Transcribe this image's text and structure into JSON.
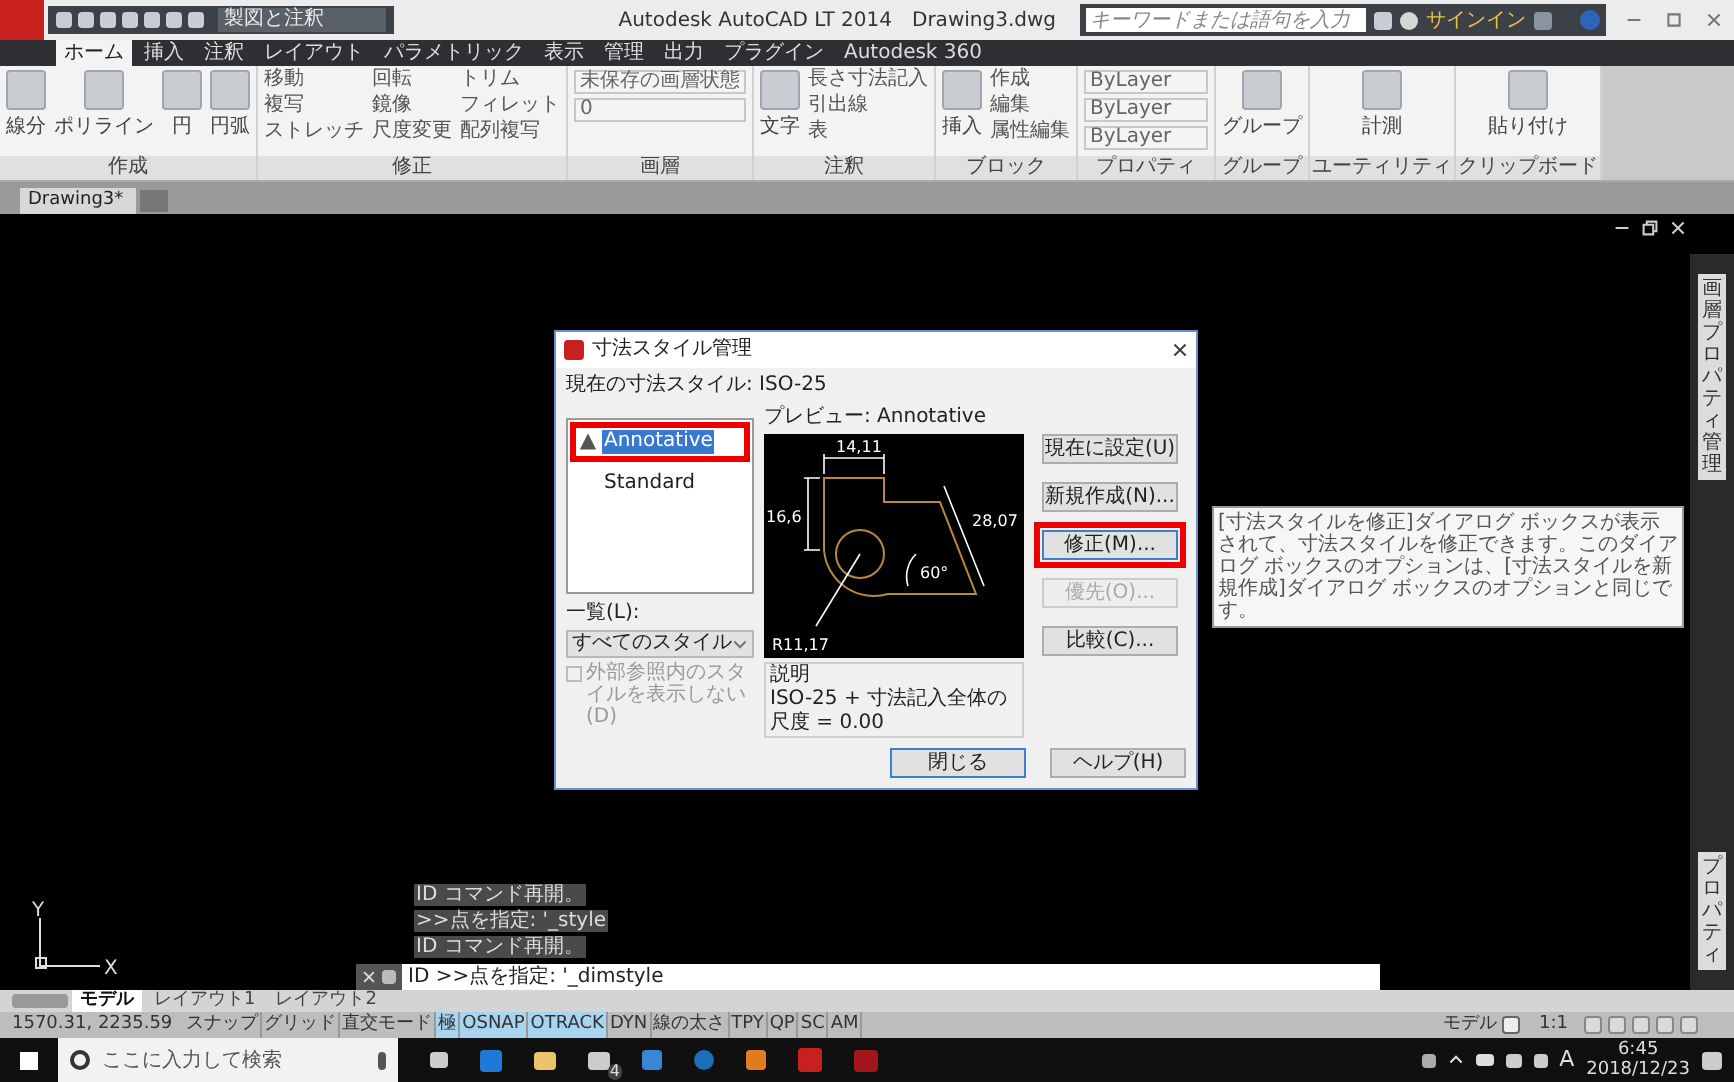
{
  "titlebar": {
    "workspace": "製図と注釈",
    "title": "Autodesk AutoCAD LT 2014",
    "file": "Drawing3.dwg",
    "search": {
      "placeholder": "キーワードまたは語句を入力"
    },
    "signin": "サインイン"
  },
  "ribbon_tabs": [
    {
      "label": "ホーム",
      "selected": true
    },
    {
      "label": "挿入",
      "selected": false
    },
    {
      "label": "注釈",
      "selected": false
    },
    {
      "label": "レイアウト",
      "selected": false
    },
    {
      "label": "パラメトリック",
      "selected": false
    },
    {
      "label": "表示",
      "selected": false
    },
    {
      "label": "管理",
      "selected": false
    },
    {
      "label": "出力",
      "selected": false
    },
    {
      "label": "プラグイン",
      "selected": false
    },
    {
      "label": "Autodesk 360",
      "selected": false
    }
  ],
  "ribbon_panels": [
    {
      "title": "作成",
      "groups": [
        {
          "kind": "large",
          "label": "線分"
        },
        {
          "kind": "large",
          "label": "ポリライン"
        },
        {
          "kind": "large",
          "label": "円"
        },
        {
          "kind": "large",
          "label": "円弧"
        }
      ]
    },
    {
      "title": "修正",
      "groups": [
        {
          "kind": "column",
          "items": [
            "移動",
            "複写",
            "ストレッチ"
          ]
        },
        {
          "kind": "column",
          "items": [
            "回転",
            "鏡像",
            "尺度変更"
          ]
        },
        {
          "kind": "column",
          "items": [
            "トリム",
            "フィレット",
            "配列複写"
          ]
        }
      ]
    },
    {
      "title": "画層",
      "groups": [
        {
          "kind": "dropdown",
          "items": [
            "未保存の画層状態",
            "0"
          ]
        }
      ]
    },
    {
      "title": "注釈",
      "groups": [
        {
          "kind": "large",
          "label": "文字"
        },
        {
          "kind": "column",
          "items": [
            "長さ寸法記入",
            "引出線",
            "表"
          ]
        }
      ]
    },
    {
      "title": "ブロック",
      "groups": [
        {
          "kind": "large",
          "label": "挿入"
        },
        {
          "kind": "column",
          "items": [
            "作成",
            "編集",
            "属性編集"
          ]
        }
      ]
    },
    {
      "title": "プロパティ",
      "groups": [
        {
          "kind": "dropdown",
          "items": [
            "ByLayer",
            "ByLayer",
            "ByLayer"
          ]
        }
      ]
    },
    {
      "title": "グループ",
      "groups": [
        {
          "kind": "large",
          "label": "グループ"
        }
      ]
    },
    {
      "title": "ユーティリティ",
      "groups": [
        {
          "kind": "large",
          "label": "計測"
        }
      ]
    },
    {
      "title": "クリップボード",
      "groups": [
        {
          "kind": "large",
          "label": "貼り付け"
        }
      ]
    }
  ],
  "doc_tabs": [
    {
      "label": "Drawing3*",
      "selected": true
    }
  ],
  "palettes": [
    {
      "label": "画層プロパティ管理"
    },
    {
      "label": "プロパティ"
    }
  ],
  "ucs": {
    "x": "X",
    "y": "Y"
  },
  "dialog": {
    "title": "寸法スタイル管理",
    "current": "現在の寸法スタイル: ISO-25",
    "styles": [
      {
        "name": "Annotative",
        "annotative": true,
        "selected": true,
        "highlighted": true
      },
      {
        "name": "Standard",
        "annotative": false,
        "selected": false,
        "highlighted": false
      }
    ],
    "list_label": "一覧(L):",
    "list_value": "すべてのスタイル",
    "xref_checkbox": {
      "label": "外部参照内のスタイルを表示しない(D)",
      "checked": false,
      "disabled": true
    },
    "preview_label": "プレビュー: Annotative",
    "preview_dims": [
      "14,11",
      "16,6",
      "28,07",
      "60°",
      "R11,17"
    ],
    "description_label": "説明",
    "description": "ISO-25 + 寸法記入全体の尺度 = 0.00",
    "side_buttons": [
      {
        "label": "現在に設定(U)",
        "disabled": false,
        "focused": false,
        "highlighted": false
      },
      {
        "label": "新規作成(N)...",
        "disabled": false,
        "focused": false,
        "highlighted": false
      },
      {
        "label": "修正(M)...",
        "disabled": false,
        "focused": true,
        "highlighted": true
      },
      {
        "label": "優先(O)...",
        "disabled": true,
        "focused": false,
        "highlighted": false
      },
      {
        "label": "比較(C)...",
        "disabled": false,
        "focused": false,
        "highlighted": false
      }
    ],
    "bottom_buttons": [
      {
        "label": "閉じる",
        "focused": true
      },
      {
        "label": "ヘルプ(H)",
        "focused": false
      }
    ]
  },
  "tooltip": "[寸法スタイルを修正]ダイアログ ボックスが表示されて、寸法スタイルを修正できます。このダイアログ ボックスのオプションは、[寸法スタイルを新規作成]ダイアログ ボックスのオプションと同じです。",
  "command_history": [
    "ID コマンド再開。",
    ">>点を指定: '_style",
    "ID コマンド再開。"
  ],
  "command_line": "ID >>点を指定: '_dimstyle",
  "layout_tabs": [
    {
      "label": "モデル",
      "selected": true
    },
    {
      "label": "レイアウト1",
      "selected": false
    },
    {
      "label": "レイアウト2",
      "selected": false
    }
  ],
  "status_bar": {
    "coords": "1570.31, 2235.59",
    "toggles": [
      {
        "label": "スナップ",
        "on": false
      },
      {
        "label": "グリッド",
        "on": false
      },
      {
        "label": "直交モード",
        "on": false
      },
      {
        "label": "極",
        "on": true
      },
      {
        "label": "OSNAP",
        "on": true
      },
      {
        "label": "OTRACK",
        "on": true
      },
      {
        "label": "DYN",
        "on": false
      },
      {
        "label": "線の太さ",
        "on": false
      },
      {
        "label": "TPY",
        "on": false
      },
      {
        "label": "QP",
        "on": false
      },
      {
        "label": "SC",
        "on": false
      },
      {
        "label": "AM",
        "on": false
      }
    ],
    "space": "モデル",
    "scale": "1:1"
  },
  "taskbar": {
    "search": {
      "placeholder": "ここに入力して検索"
    },
    "mail_count": "4",
    "ime": "A",
    "time": "6:45",
    "date": "2018/12/23"
  }
}
